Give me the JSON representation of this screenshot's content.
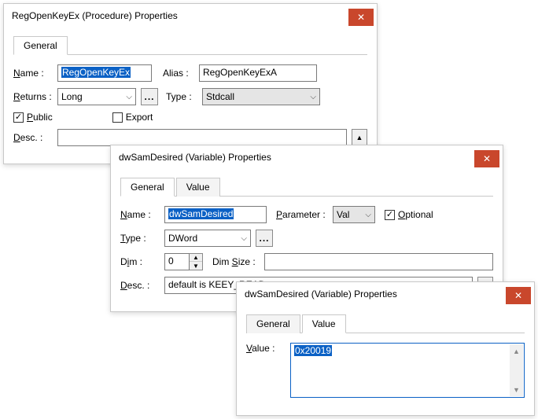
{
  "dialog1": {
    "title": "RegOpenKeyEx (Procedure) Properties",
    "tabs": {
      "general": "General"
    },
    "labels": {
      "name": "Name :",
      "alias": "Alias :",
      "returns": "Returns :",
      "type": "Type :",
      "public": "Public",
      "export": "Export",
      "desc": "Desc. :",
      "ellipsis": "..."
    },
    "values": {
      "name": "RegOpenKeyEx",
      "alias": "RegOpenKeyExA",
      "returns": "Long",
      "type": "Stdcall",
      "public_checked": true,
      "export_checked": false,
      "desc": ""
    }
  },
  "dialog2": {
    "title": "dwSamDesired (Variable) Properties",
    "tabs": {
      "general": "General",
      "value": "Value"
    },
    "labels": {
      "name": "Name :",
      "parameter": "Parameter :",
      "optional": "Optional",
      "type": "Type :",
      "dim": "Dim :",
      "dimsize": "Dim Size :",
      "desc": "Desc. :",
      "ellipsis": "..."
    },
    "values": {
      "name": "dwSamDesired",
      "parameter": "Val",
      "optional_checked": true,
      "type": "DWord",
      "dim": "0",
      "dimsize": "",
      "desc": "default is KEEY_READ"
    }
  },
  "dialog3": {
    "title": "dwSamDesired (Variable) Properties",
    "tabs": {
      "general": "General",
      "value": "Value"
    },
    "labels": {
      "value": "Value :"
    },
    "values": {
      "value": "0x20019"
    }
  },
  "icons": {
    "close": "✕",
    "caret": "⌵",
    "up": "▲",
    "down": "▼"
  }
}
